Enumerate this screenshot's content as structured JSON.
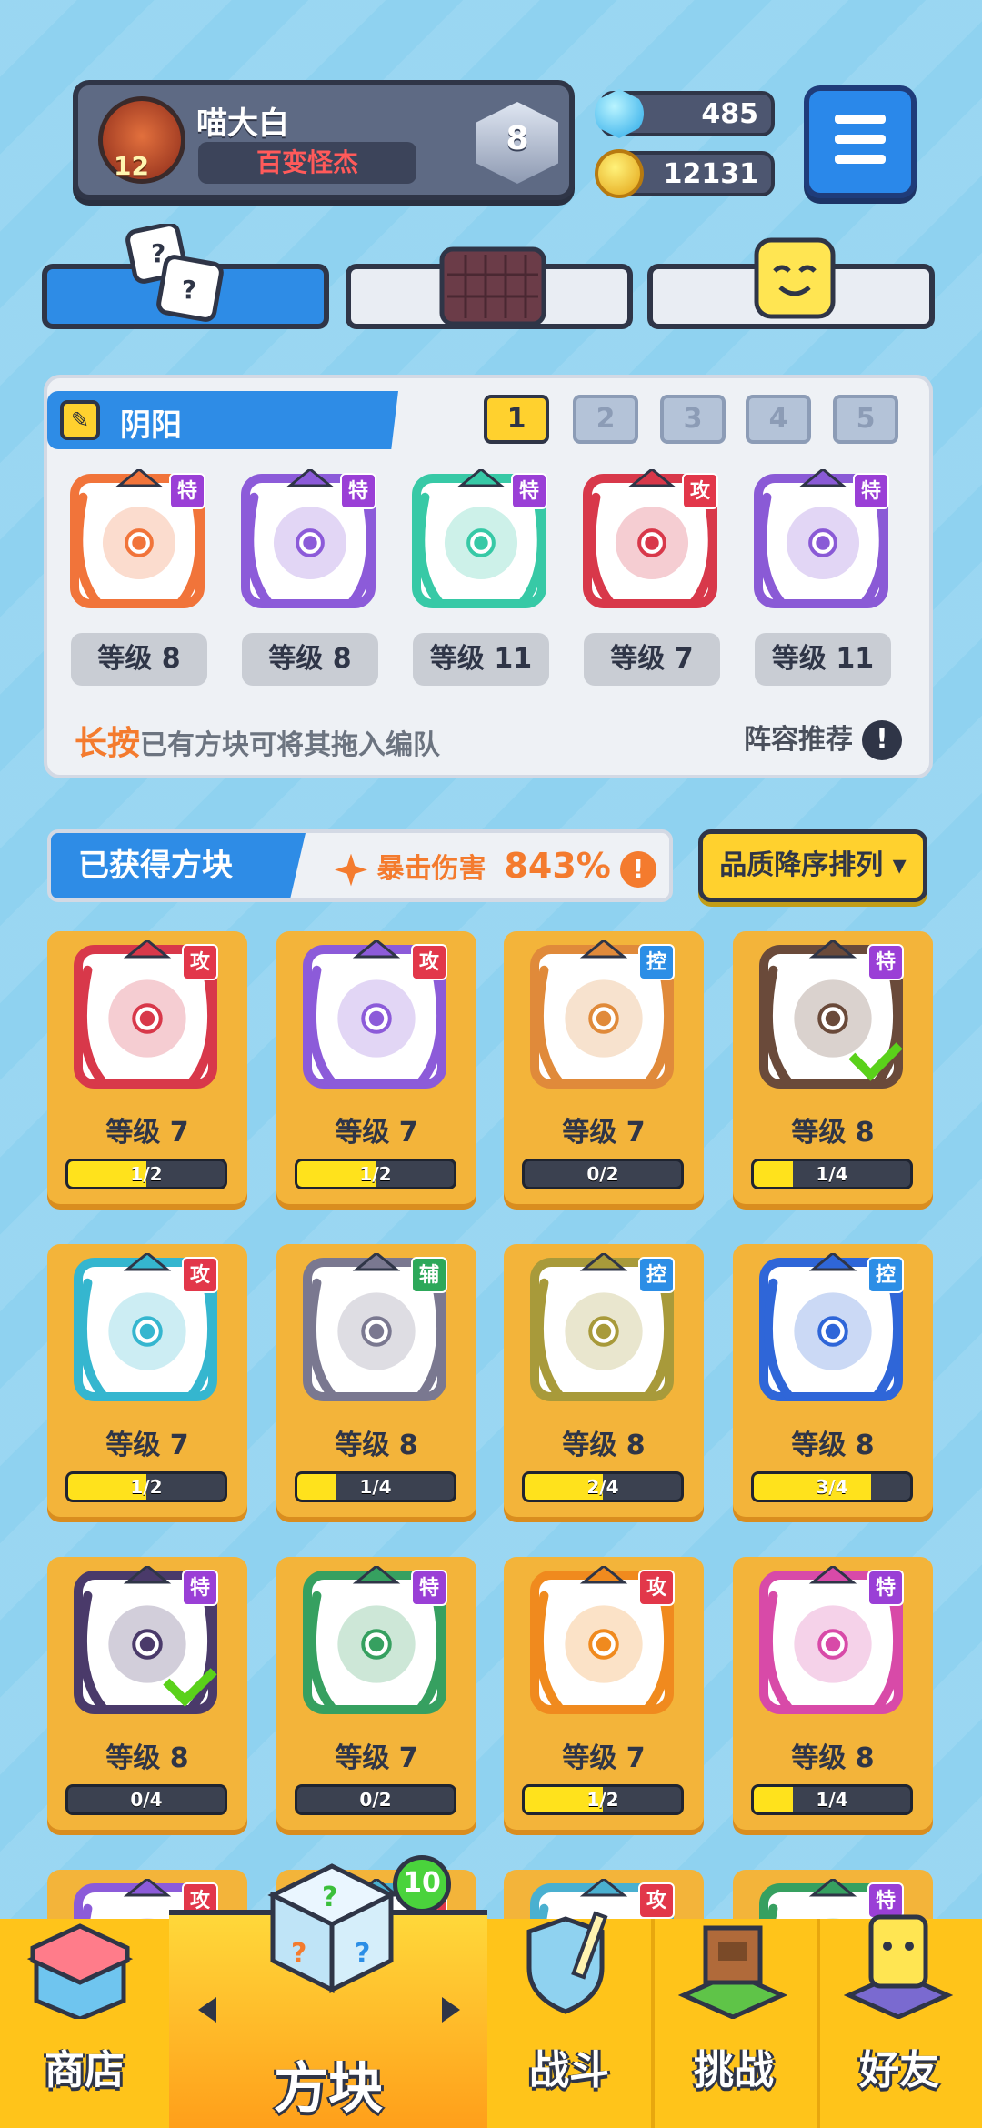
{
  "header": {
    "player_name": "喵大白",
    "player_title": "百变怪杰",
    "player_level": "12",
    "rank_badge": "8",
    "gems": "485",
    "coins": "12131"
  },
  "tabs": [
    {
      "icon": "dice-icon",
      "active": true
    },
    {
      "icon": "board-icon",
      "active": false
    },
    {
      "icon": "smiley-block-icon",
      "active": false
    }
  ],
  "lineup": {
    "name": "阴阳",
    "slots": [
      "1",
      "2",
      "3",
      "4",
      "5"
    ],
    "selected_slot": 1,
    "blocks": [
      {
        "tag": "特",
        "level": "等级 8",
        "color": "#f1743a",
        "icon": "infinity-icon"
      },
      {
        "tag": "特",
        "level": "等级 8",
        "color": "#8c5bd9",
        "icon": "target-icon"
      },
      {
        "tag": "特",
        "level": "等级 11",
        "color": "#37c9a6",
        "icon": "hands-icon"
      },
      {
        "tag": "攻",
        "level": "等级 7",
        "color": "#d8384a",
        "icon": "saw-icon"
      },
      {
        "tag": "特",
        "level": "等级 11",
        "color": "#8a5ad6",
        "icon": "crack-icon"
      }
    ],
    "hint_key": "长按",
    "hint_text": "已有方块可将其拖入编队",
    "recommend": "阵容推荐",
    "recommend_icon": "!"
  },
  "collection": {
    "label": "已获得方块",
    "crit_label": "暴击伤害",
    "crit_value": "843%",
    "crit_icon": "!",
    "sort": "品质降序排列 ▾",
    "cards": [
      {
        "tag": "攻",
        "tag_type": "atk",
        "color": "#d8384a",
        "level": "等级 7",
        "progress": "1/2",
        "fill": 0.5
      },
      {
        "tag": "攻",
        "tag_type": "atk",
        "color": "#8c5bd9",
        "level": "等级 7",
        "progress": "1/2",
        "fill": 0.5
      },
      {
        "tag": "控",
        "tag_type": "ctl",
        "color": "#e08a3a",
        "level": "等级 7",
        "progress": "0/2",
        "fill": 0
      },
      {
        "tag": "特",
        "tag_type": "spc",
        "color": "#6a4a3a",
        "level": "等级 8",
        "progress": "1/4",
        "fill": 0.25,
        "equipped": true
      },
      {
        "tag": "攻",
        "tag_type": "atk",
        "color": "#35b6cf",
        "level": "等级 7",
        "progress": "1/2",
        "fill": 0.5
      },
      {
        "tag": "辅",
        "tag_type": "sup",
        "color": "#7a7890",
        "level": "等级 8",
        "progress": "1/4",
        "fill": 0.25
      },
      {
        "tag": "控",
        "tag_type": "ctl",
        "color": "#a89a3a",
        "level": "等级 8",
        "progress": "2/4",
        "fill": 0.5
      },
      {
        "tag": "控",
        "tag_type": "ctl",
        "color": "#2f66d8",
        "level": "等级 8",
        "progress": "3/4",
        "fill": 0.75
      },
      {
        "tag": "特",
        "tag_type": "spc",
        "color": "#4a3a6a",
        "level": "等级 8",
        "progress": "0/4",
        "fill": 0,
        "equipped": true
      },
      {
        "tag": "特",
        "tag_type": "spc",
        "color": "#36a060",
        "level": "等级 7",
        "progress": "0/2",
        "fill": 0
      },
      {
        "tag": "攻",
        "tag_type": "atk",
        "color": "#f08a1e",
        "level": "等级 7",
        "progress": "1/2",
        "fill": 0.5
      },
      {
        "tag": "特",
        "tag_type": "spc",
        "color": "#d84aa8",
        "level": "等级 8",
        "progress": "1/4",
        "fill": 0.25
      },
      {
        "tag": "攻",
        "tag_type": "atk",
        "color": "#8c5bd9"
      },
      {
        "tag": "攻",
        "tag_type": "atk",
        "color": "#4ab0d0"
      },
      {
        "tag": "攻",
        "tag_type": "atk",
        "color": "#4ab0d0"
      },
      {
        "tag": "特",
        "tag_type": "spc",
        "color": "#36a060"
      }
    ]
  },
  "nav": {
    "shop": "商店",
    "blocks": "方块",
    "battle": "战斗",
    "challenge": "挑战",
    "friends": "好友",
    "blocks_badge": "10"
  },
  "colors": {
    "atk": "#e2374a",
    "ctl": "#2c8ee6",
    "spc": "#9a3fd6",
    "sup": "#2da85a"
  }
}
